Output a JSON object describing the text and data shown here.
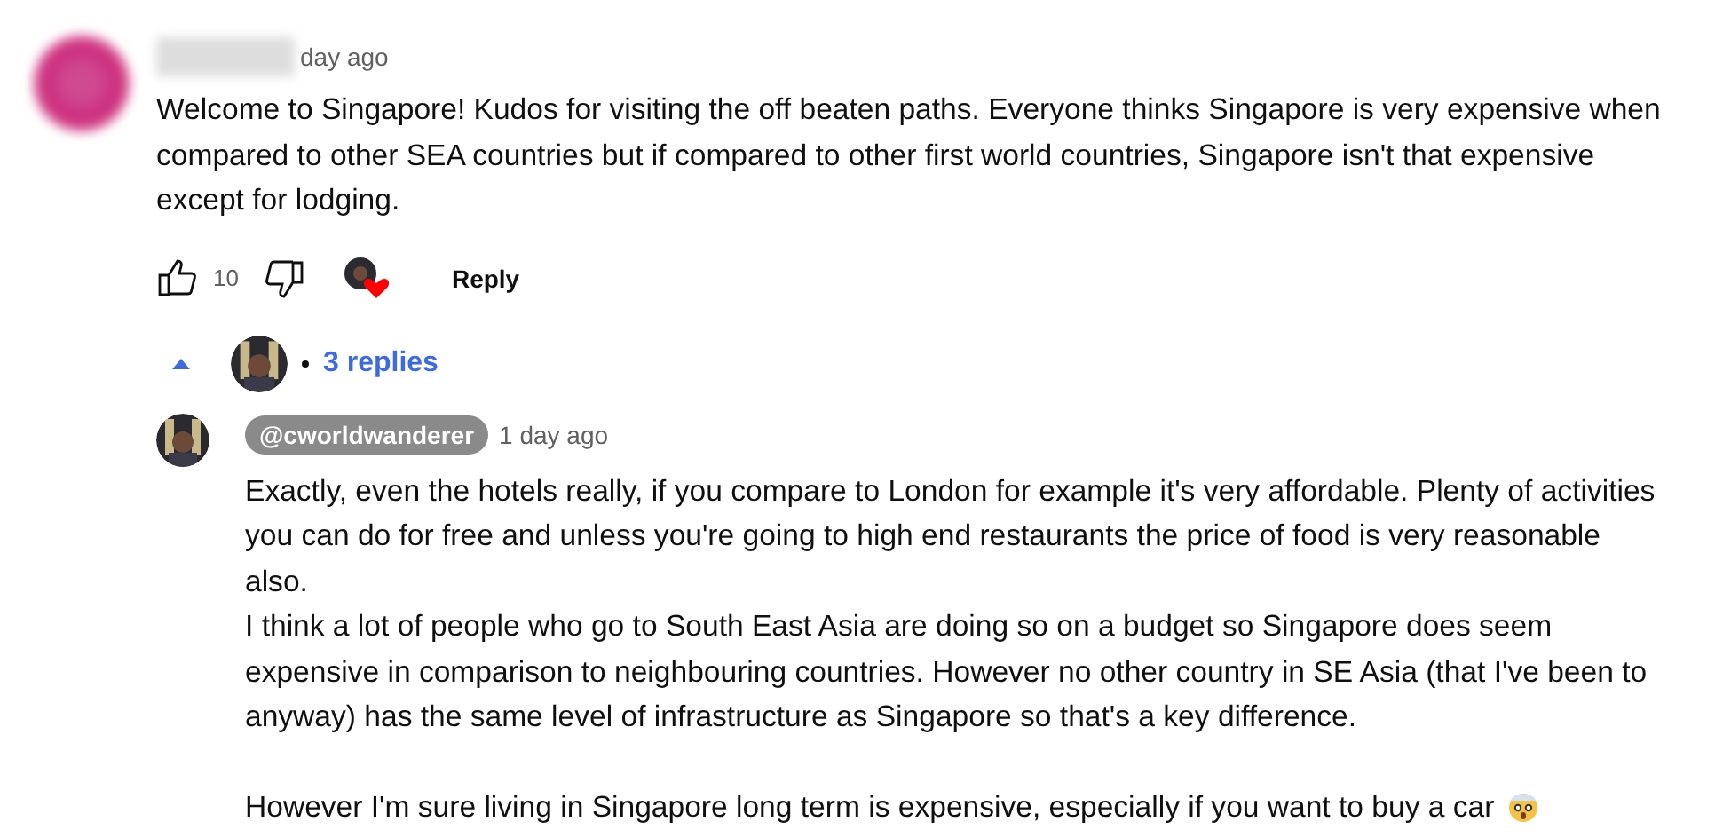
{
  "comment": {
    "time": "day ago",
    "text": "Welcome to Singapore! Kudos for visiting the off beaten paths. Everyone thinks Singapore is very expensive when compared to other SEA countries but if compared to other first world countries, Singapore isn't that expensive except for lodging.",
    "likes": "10",
    "creator_heart": true,
    "reply_button": "Reply"
  },
  "replies_toggle": {
    "expanded": true,
    "label": "3 replies"
  },
  "reply": {
    "author": "@cworldwanderer",
    "time": "1 day ago",
    "paragraphs": [
      "Exactly, even the hotels really, if you compare to London for example it's very affordable. Plenty of activities you can do for free and unless you're going to high end restaurants the price of food is very reasonable also.",
      "I think a lot of people who go to South East Asia are doing so on a budget so Singapore does seem expensive in comparison to neighbouring countries. However no other country in SE Asia (that I've been to anyway) has the same level of infrastructure as Singapore so that's a key difference.",
      "However I'm sure living in Singapore long term is expensive, especially if you want to buy a car"
    ]
  }
}
